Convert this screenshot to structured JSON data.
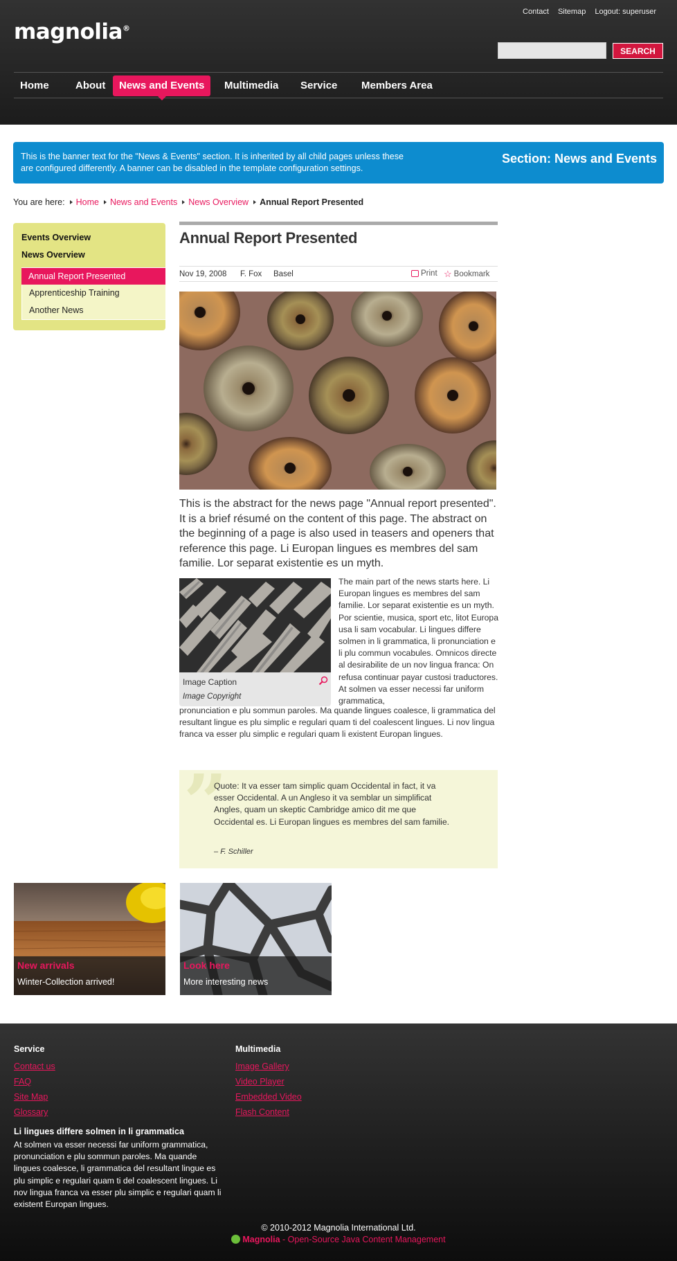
{
  "header": {
    "logo": "magnolia",
    "logo_mark": "®",
    "top_links": [
      "Contact",
      "Sitemap",
      "Logout: superuser"
    ],
    "search": {
      "placeholder": "",
      "button": "SEARCH"
    },
    "nav": [
      "Home",
      "About",
      "News and Events",
      "Multimedia",
      "Service",
      "Members Area"
    ],
    "nav_active": "News and Events"
  },
  "banner": {
    "text": "This is the banner text for the \"News & Events\" section. It is inherited by all child pages unless these are configured differently. A banner can be disabled in the template configuration settings.",
    "section": "Section: News and Events"
  },
  "breadcrumb": {
    "prefix": "You are here:",
    "items": [
      "Home",
      "News and Events",
      "News Overview"
    ],
    "current": "Annual Report Presented"
  },
  "sidebar": {
    "headings": [
      "Events Overview",
      "News Overview"
    ],
    "items": [
      "Annual Report Presented",
      "Apprenticeship Training",
      "Another News"
    ],
    "active": "Annual Report Presented"
  },
  "article": {
    "title": "Annual Report Presented",
    "date": "Nov 19, 2008",
    "author": "F. Fox",
    "location": "Basel",
    "print": "Print",
    "bookmark": "Bookmark",
    "abstract": "This is the abstract for the news page \"Annual report presented\". It is a brief résumé on the content of this page. The abstract on the beginning of a page is also used in teasers and openers that reference this page. Li Europan lingues es membres del sam familie. Lor separat existentie es un myth.",
    "image_caption": "Image Caption",
    "image_copyright": "Image Copyright",
    "body_right": "The main part of the news starts here. Li Europan lingues es membres del sam familie. Lor separat existentie es un myth. Por scientie, musica, sport etc, litot Europa usa li sam vocabular. Li lingues differe solmen in li grammatica, li pronunciation e li plu commun vocabules. Omnicos directe al desirabilite de un nov lingua franca: On refusa continuar payar custosi traductores. At solmen va esser necessi far uniform grammatica,",
    "body_full": "pronunciation e plu sommun paroles. Ma quande lingues coalesce, li grammatica del resultant lingue es plu simplic e regulari quam ti del coalescent lingues. Li nov lingua franca va esser plu simplic e regulari quam li existent Europan lingues.",
    "quote": "Quote: It va esser tam simplic quam Occidental in fact, it va esser Occidental. A un Angleso it va semblar un simplificat Angles, quam un skeptic Cambridge amico dit me que Occidental es. Li Europan lingues es membres del sam familie.",
    "quote_dash": "–",
    "quote_author": "F. Schiller"
  },
  "teasers": [
    {
      "title": "New arrivals",
      "subtitle": "Winter-Collection arrived!"
    },
    {
      "title": "Look here",
      "subtitle": "More interesting news"
    }
  ],
  "footer": {
    "columns": [
      {
        "heading": "Service",
        "links": [
          "Contact us",
          "FAQ",
          "Site Map",
          "Glossary"
        ]
      },
      {
        "heading": "Multimedia",
        "links": [
          "Image Gallery",
          "Video Player",
          "Embedded Video",
          "Flash Content"
        ]
      }
    ],
    "text_heading": "Li lingues differe solmen in li grammatica",
    "text": "At solmen va esser necessi far uniform grammatica, pronunciation e plu sommun paroles. Ma quande lingues coalesce, li grammatica del resultant lingue es plu simplic e regulari quam ti del coalescent lingues. Li nov lingua franca va esser plu simplic e regulari quam li existent Europan lingues.",
    "copyright": "© 2010-2012 Magnolia International Ltd.",
    "powered_brand": "Magnolia",
    "powered_text": " - Open-Source Java Content Management"
  },
  "colors": {
    "accent": "#e8175d",
    "banner": "#0d8ccf",
    "sidebar": "#e3e484",
    "quote_bg": "#f5f6d9"
  }
}
